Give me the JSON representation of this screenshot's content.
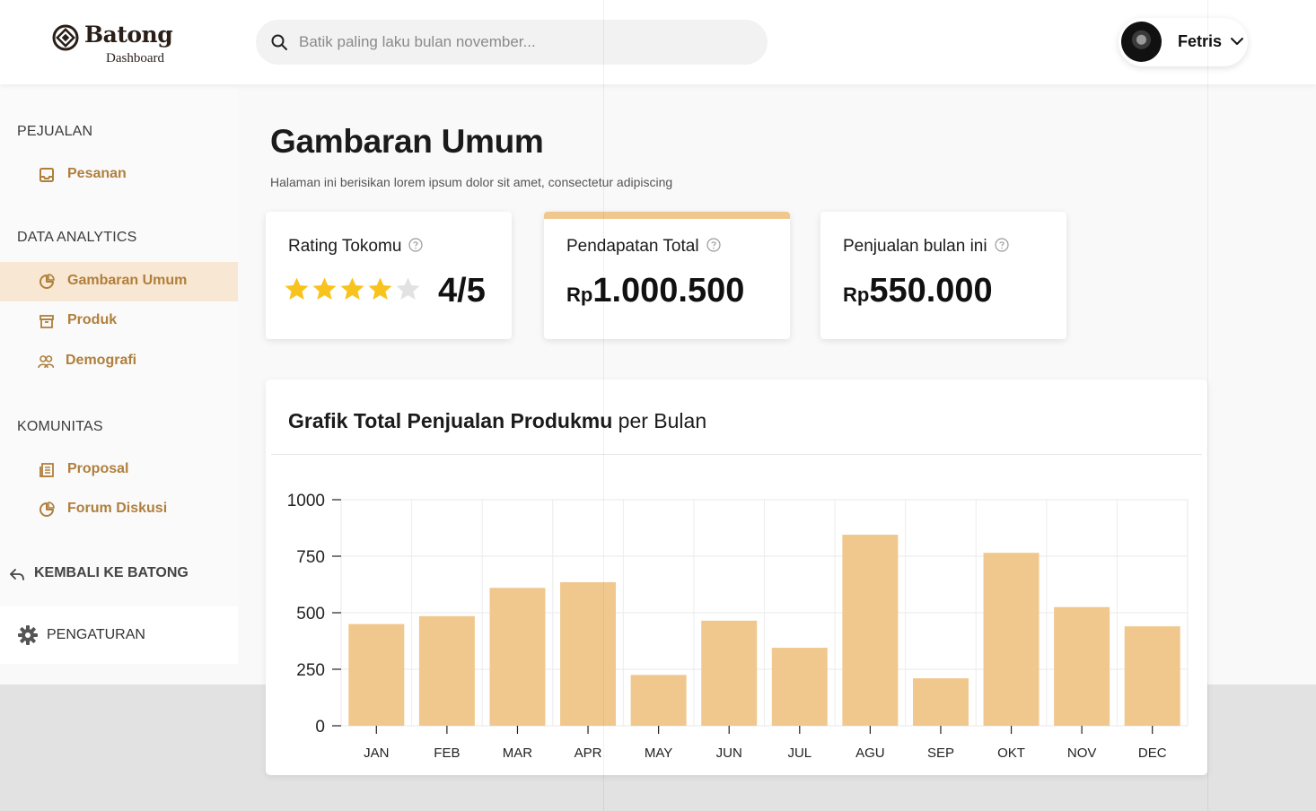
{
  "header": {
    "logo_text": "Batong",
    "logo_sub": "Dashboard",
    "search_placeholder": "Batik paling laku bulan november...",
    "user_name": "Fetris"
  },
  "sidebar": {
    "sections": [
      {
        "title": "PEJUALAN",
        "items": [
          {
            "label": "Pesanan",
            "icon": "inbox-icon"
          }
        ]
      },
      {
        "title": "DATA ANALYTICS",
        "items": [
          {
            "label": "Gambaran Umum",
            "icon": "pie-chart-icon",
            "active": true
          },
          {
            "label": "Produk",
            "icon": "archive-icon"
          },
          {
            "label": "Demografi",
            "icon": "users-icon"
          }
        ]
      },
      {
        "title": "KOMUNITAS",
        "items": [
          {
            "label": "Proposal",
            "icon": "document-icon"
          },
          {
            "label": "Forum Diskusi",
            "icon": "pie-chart-icon"
          }
        ]
      }
    ],
    "back_label": "KEMBALI KE BATONG",
    "settings_label": "PENGATURAN"
  },
  "main": {
    "title": "Gambaran Umum",
    "description": "Halaman ini berisikan lorem ipsum dolor sit amet, consectetur adipiscing",
    "cards": [
      {
        "title": "Rating Tokomu",
        "value": "4/5",
        "stars_filled": 4,
        "stars_total": 5
      },
      {
        "title": "Pendapatan Total",
        "currency": "Rp",
        "value": "1.000.500",
        "highlighted": true
      },
      {
        "title": "Penjualan bulan ini",
        "currency": "Rp",
        "value": "550.000"
      }
    ],
    "chart_title_bold": "Grafik Total Penjualan Produkmu",
    "chart_title_rest": " per Bulan"
  },
  "colors": {
    "accent": "#b07f3c",
    "bar": "#f0c88e",
    "active_bg": "#f8e7d2",
    "star": "#f9c31d"
  },
  "chart_data": {
    "type": "bar",
    "categories": [
      "JAN",
      "FEB",
      "MAR",
      "APR",
      "MAY",
      "JUN",
      "JUL",
      "AGU",
      "SEP",
      "OKT",
      "NOV",
      "DEC"
    ],
    "values": [
      450,
      485,
      610,
      635,
      225,
      465,
      345,
      845,
      210,
      765,
      525,
      440
    ],
    "yticks": [
      0,
      250,
      500,
      750,
      1000
    ],
    "ylim": [
      0,
      1000
    ],
    "grid": true,
    "xlabel": "",
    "ylabel": ""
  }
}
